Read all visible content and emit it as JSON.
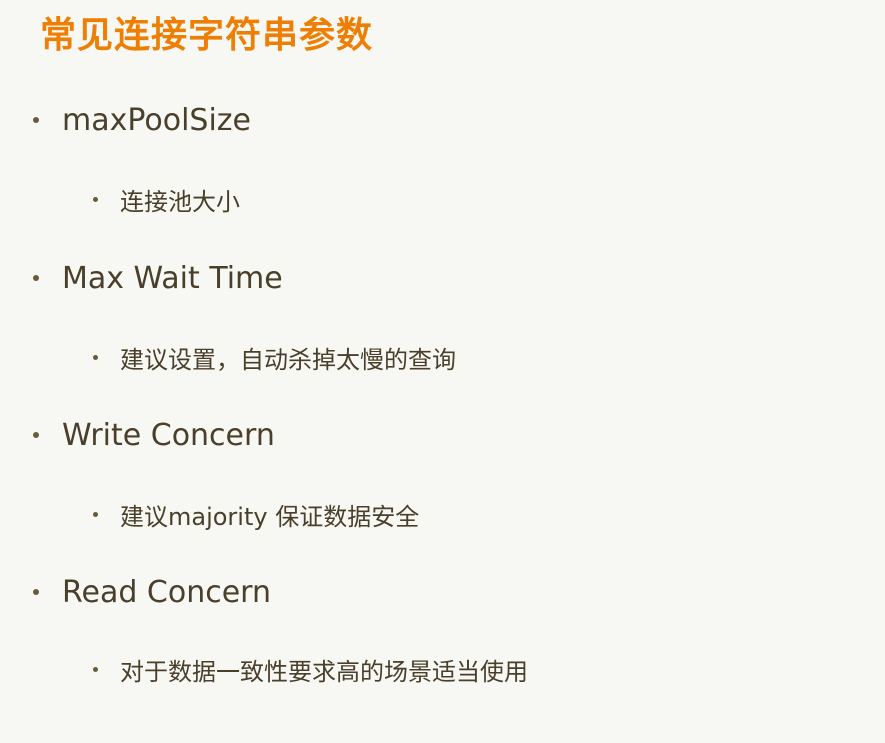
{
  "slide": {
    "title": "常见连接字符串参数",
    "items": [
      {
        "label": "maxPoolSize",
        "sub": "连接池大小"
      },
      {
        "label": "Max Wait Time",
        "sub": "建议设置，自动杀掉太慢的查询"
      },
      {
        "label": "Write Concern",
        "sub": "建议majority 保证数据安全"
      },
      {
        "label": "Read Concern",
        "sub": "对于数据一致性要求高的场景适当使用"
      }
    ]
  },
  "colors": {
    "title": "#ee7f05",
    "text": "#4a3f2a",
    "background": "#f7f7f4"
  }
}
